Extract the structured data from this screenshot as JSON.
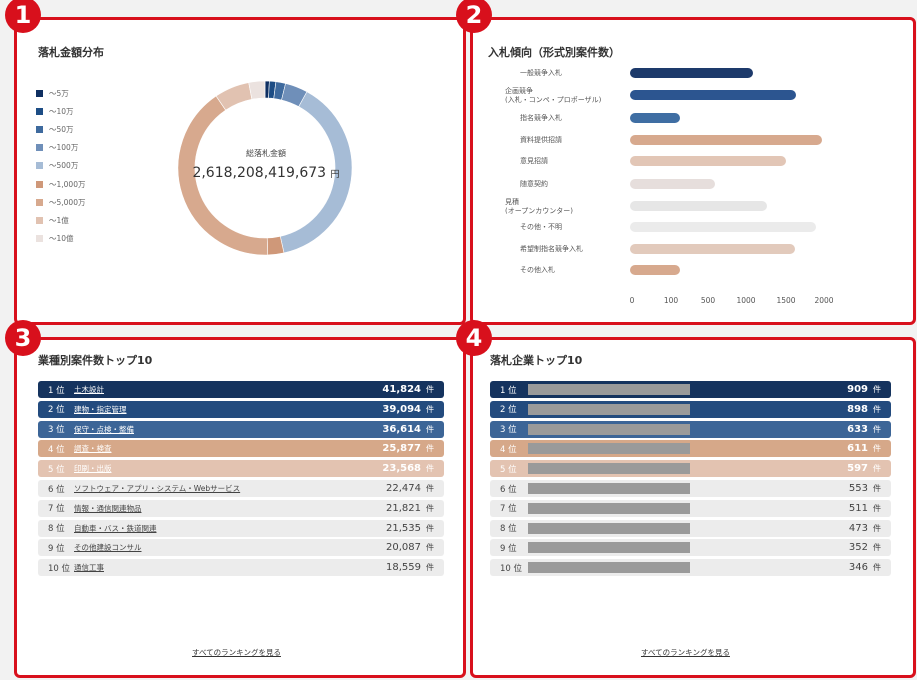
{
  "badges": [
    "1",
    "2",
    "3",
    "4"
  ],
  "panel1": {
    "title": "落札金額分布",
    "legend": [
      {
        "label": "〜5万",
        "color": "#0f2f61"
      },
      {
        "label": "〜10万",
        "color": "#1d4d85"
      },
      {
        "label": "〜50万",
        "color": "#3e6a9e"
      },
      {
        "label": "〜100万",
        "color": "#6f8fb9"
      },
      {
        "label": "〜500万",
        "color": "#a6bcd6"
      },
      {
        "label": "〜1,000万",
        "color": "#cf9879"
      },
      {
        "label": "〜5,000万",
        "color": "#d7a98e"
      },
      {
        "label": "〜1億",
        "color": "#e1c2b1"
      },
      {
        "label": "〜10億",
        "color": "#ebe2df"
      }
    ],
    "center_label": "総落札金額",
    "center_value": "2,618,208,419,673",
    "center_unit": "円"
  },
  "panel2": {
    "title": "入札傾向（形式別案件数）"
  },
  "chart_data": [
    {
      "type": "pie",
      "title": "落札金額分布",
      "categories": [
        "〜5万",
        "〜10万",
        "〜50万",
        "〜100万",
        "〜500万",
        "〜1,000万",
        "〜5,000万",
        "〜1億",
        "〜10億"
      ],
      "values": [
        0.8,
        1.2,
        1.8,
        4.2,
        38.5,
        3.0,
        41.0,
        6.5,
        3.0
      ],
      "colors": [
        "#0f2f61",
        "#1d4d85",
        "#3e6a9e",
        "#6f8fb9",
        "#a6bcd6",
        "#cf9879",
        "#d7a98e",
        "#e1c2b1",
        "#ebe2df"
      ],
      "donut": true
    },
    {
      "type": "bar",
      "orientation": "horizontal",
      "title": "入札傾向（形式別案件数）",
      "categories": [
        "一般競争入札",
        "企画競争\n(入札・コンペ・プロポーザル)",
        "指名競争入札",
        "資料提供招請",
        "意見招請",
        "随意契約",
        "見積\n(オープンカウンター)",
        "その他・不明",
        "希望制指名競争入札",
        "その他入札"
      ],
      "values": [
        1270,
        1720,
        520,
        1990,
        1620,
        880,
        1420,
        1930,
        1710,
        520
      ],
      "colors": [
        "#1d3a6b",
        "#2c5590",
        "#3f6ea3",
        "#d7a98e",
        "#e2c6b6",
        "#e6dedc",
        "#e6e6e6",
        "#ebebeb",
        "#e2cabc",
        "#d7a98e"
      ],
      "xticks": [
        "0",
        "100",
        "500",
        "1000",
        "1500",
        "2000"
      ]
    }
  ],
  "panel3": {
    "title": "業種別案件数トップ10",
    "unit": "件",
    "more": "すべてのランキングを見る",
    "rows": [
      {
        "rank": "1 位",
        "name": "土木設計",
        "value": "41,824"
      },
      {
        "rank": "2 位",
        "name": "建物・指定管理",
        "value": "39,094"
      },
      {
        "rank": "3 位",
        "name": "保守・点検・整備",
        "value": "36,614"
      },
      {
        "rank": "4 位",
        "name": "調査・検査",
        "value": "25,877"
      },
      {
        "rank": "5 位",
        "name": "印刷・出版",
        "value": "23,568"
      },
      {
        "rank": "6 位",
        "name": "ソフトウェア・アプリ・システム・Webサービス",
        "value": "22,474"
      },
      {
        "rank": "7 位",
        "name": "情報・通信関連物品",
        "value": "21,821"
      },
      {
        "rank": "8 位",
        "name": "自動車・バス・鉄道関連",
        "value": "21,535"
      },
      {
        "rank": "9 位",
        "name": "その他建設コンサル",
        "value": "20,087"
      },
      {
        "rank": "10 位",
        "name": "通信工事",
        "value": "18,559"
      }
    ]
  },
  "panel4": {
    "title": "落札企業トップ10",
    "unit": "件",
    "more": "すべてのランキングを見る",
    "rows": [
      {
        "rank": "1 位",
        "value": "909"
      },
      {
        "rank": "2 位",
        "value": "898"
      },
      {
        "rank": "3 位",
        "value": "633"
      },
      {
        "rank": "4 位",
        "value": "611"
      },
      {
        "rank": "5 位",
        "value": "597"
      },
      {
        "rank": "6 位",
        "value": "553"
      },
      {
        "rank": "7 位",
        "value": "511"
      },
      {
        "rank": "8 位",
        "value": "473"
      },
      {
        "rank": "9 位",
        "value": "352"
      },
      {
        "rank": "10 位",
        "value": "346"
      }
    ]
  },
  "row_styles": [
    {
      "bg": "#15335e",
      "fg": "#ffffff"
    },
    {
      "bg": "#234b7e",
      "fg": "#ffffff"
    },
    {
      "bg": "#3c6597",
      "fg": "#ffffff"
    },
    {
      "bg": "#d6a889",
      "fg": "#ffffff"
    },
    {
      "bg": "#e3c3b1",
      "fg": "#ffffff"
    },
    {
      "bg": "#ececec",
      "fg": "#444444"
    },
    {
      "bg": "#ececec",
      "fg": "#444444"
    },
    {
      "bg": "#ececec",
      "fg": "#444444"
    },
    {
      "bg": "#ececec",
      "fg": "#444444"
    },
    {
      "bg": "#ececec",
      "fg": "#444444"
    }
  ]
}
